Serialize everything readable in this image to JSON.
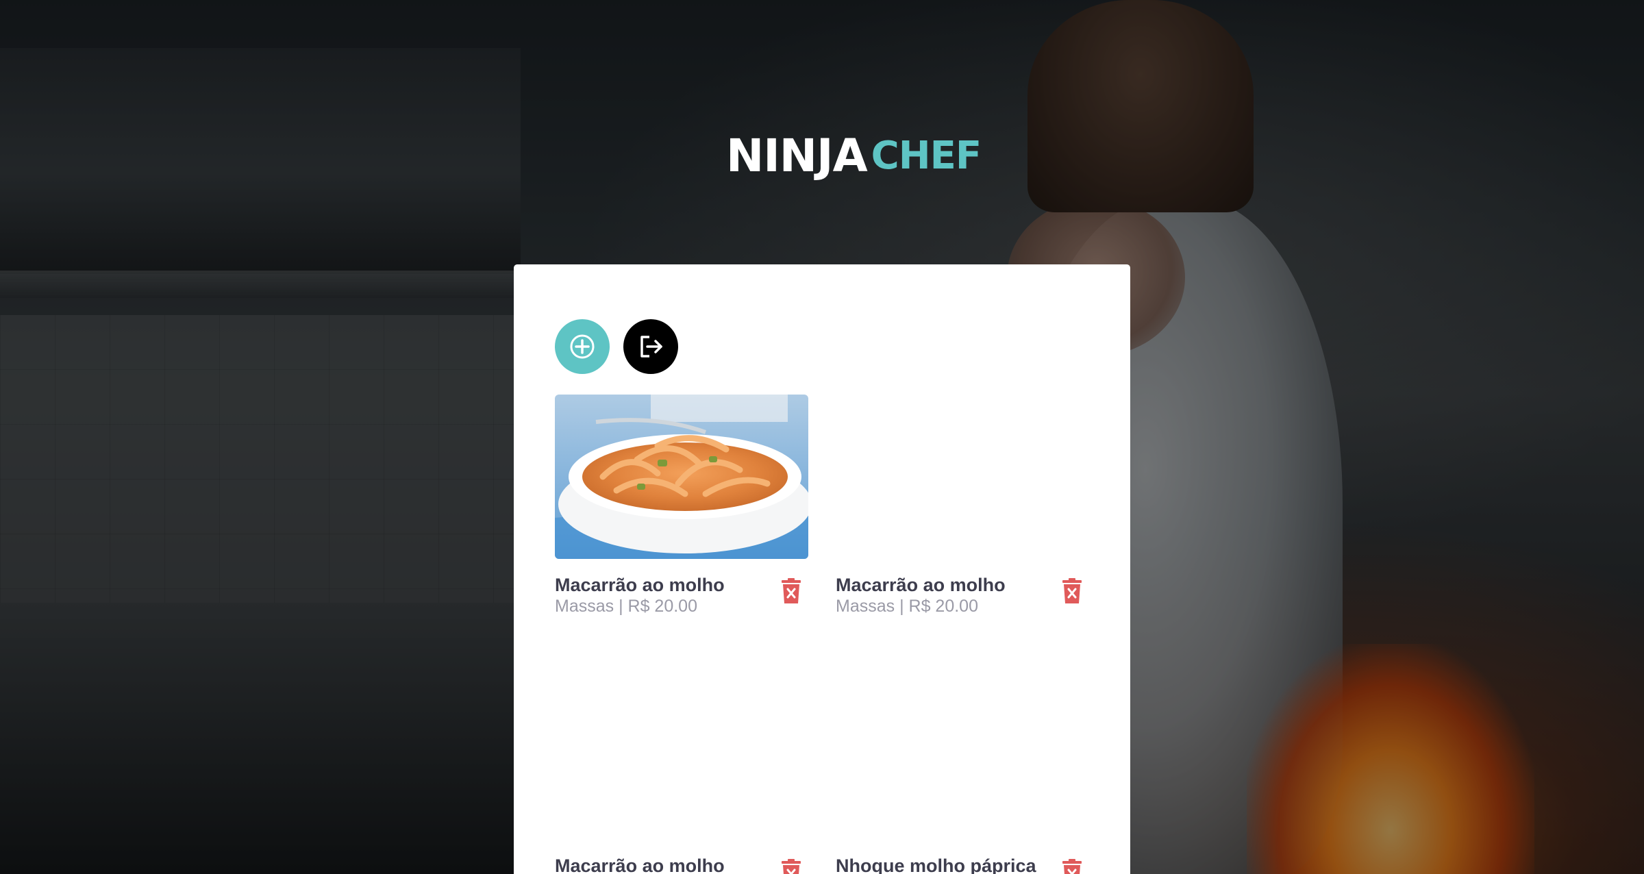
{
  "brand": {
    "logo_part1": "NINJA",
    "logo_part2": "CHEF",
    "accent_color": "#5ec4c4",
    "danger_color": "#e05a5a"
  },
  "toolbar": {
    "add_icon": "plus-circle-icon",
    "logout_icon": "logout-icon"
  },
  "dishes": [
    {
      "name": "Macarrão ao molho",
      "meta": "Massas | R$ 20.00",
      "has_photo": true,
      "delete_icon": "trash-icon"
    },
    {
      "name": "Macarrão ao molho",
      "meta": "Massas | R$ 20.00",
      "has_photo": false,
      "delete_icon": "trash-icon"
    },
    {
      "name": "Macarrão ao molho",
      "meta": "",
      "has_photo": false,
      "delete_icon": "trash-icon"
    },
    {
      "name": "Nhoque molho páprica",
      "meta": "",
      "has_photo": false,
      "delete_icon": "trash-icon"
    }
  ]
}
